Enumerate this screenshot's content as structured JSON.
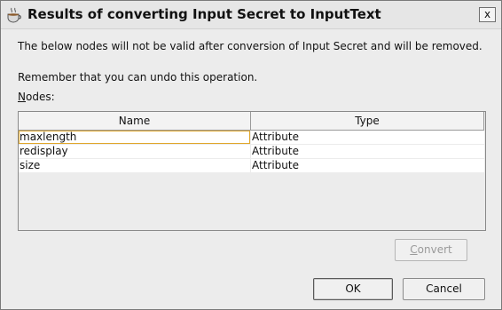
{
  "window": {
    "title": "Results of converting Input Secret to InputText",
    "close_label": "x"
  },
  "messages": {
    "line1": "The below nodes will not be valid after conversion of Input Secret and will be removed.",
    "line2": "Remember that you can undo this operation.",
    "nodes_label_mnemonic": "N",
    "nodes_label_rest": "odes:"
  },
  "table": {
    "columns": [
      "Name",
      "Type"
    ],
    "rows": [
      {
        "name": "maxlength",
        "type": "Attribute"
      },
      {
        "name": "redisplay",
        "type": "Attribute"
      },
      {
        "name": "size",
        "type": "Attribute"
      }
    ]
  },
  "buttons": {
    "convert_mnemonic": "C",
    "convert_rest": "onvert",
    "ok": "OK",
    "cancel": "Cancel"
  },
  "icons": {
    "app": "coffee-cup-icon",
    "close": "close-icon"
  }
}
